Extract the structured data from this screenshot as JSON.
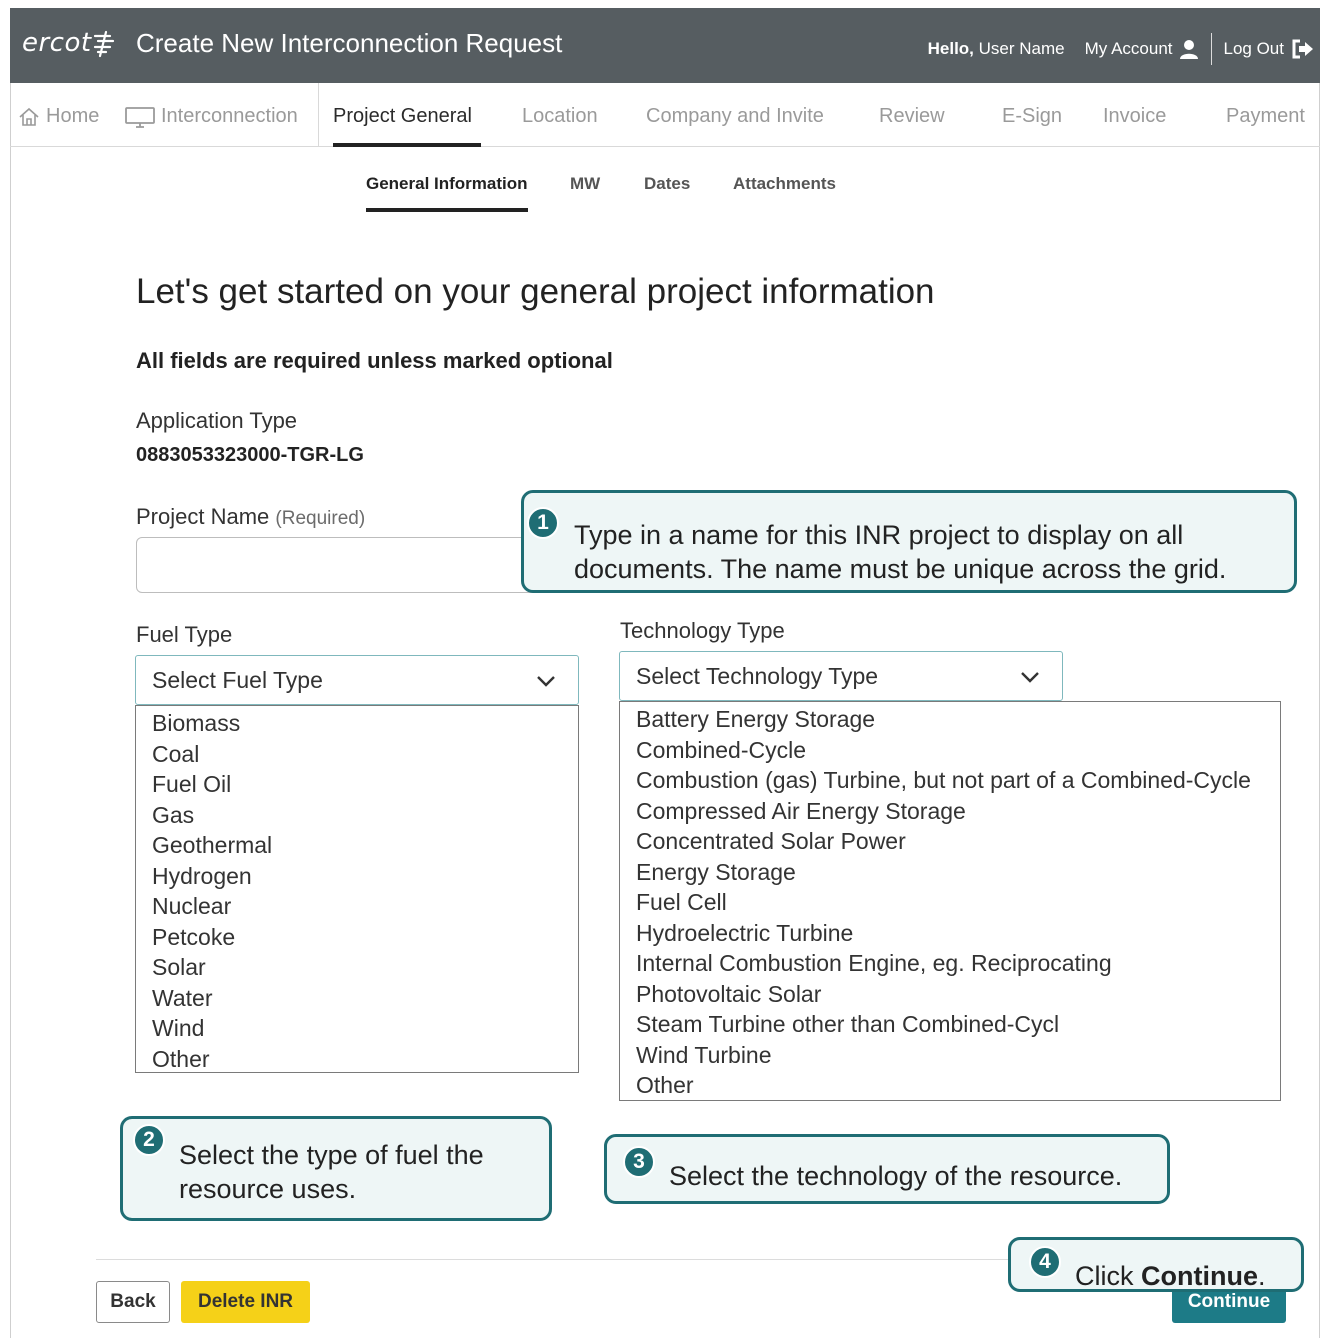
{
  "header": {
    "logo": "ercot",
    "title": "Create New Interconnection Request",
    "hello": "Hello,",
    "user_name": "User Name",
    "my_account": "My Account",
    "log_out": "Log Out"
  },
  "topnav": {
    "home": "Home",
    "interconnection": "Interconnection",
    "project_general": "Project General",
    "location": "Location",
    "company_and_invite": "Company and Invite",
    "review": "Review",
    "esign": "E-Sign",
    "invoice": "Invoice",
    "payment": "Payment"
  },
  "subtabs": {
    "general_information": "General Information",
    "mw": "MW",
    "dates": "Dates",
    "attachments": "Attachments"
  },
  "form": {
    "page_title": "Let's get started on your general project information",
    "required_note": "All fields are required unless marked optional",
    "application_type_label": "Application Type",
    "application_type_value": "0883053323000-TGR-LG",
    "project_name_label": "Project Name",
    "project_name_suffix": "(Required)",
    "project_name_value": "",
    "fuel_type_label": "Fuel Type",
    "fuel_type_placeholder": "Select Fuel Type",
    "fuel_type_options": [
      "Biomass",
      "Coal",
      "Fuel Oil",
      "Gas",
      "Geothermal",
      "Hydrogen",
      "Nuclear",
      "Petcoke",
      "Solar",
      "Water",
      "Wind",
      "Other"
    ],
    "technology_type_label": "Technology Type",
    "technology_type_placeholder": "Select Technology Type",
    "technology_type_options": [
      "Battery Energy Storage",
      "Combined-Cycle",
      "Combustion (gas) Turbine, but not part of a Combined-Cycle",
      "Compressed Air Energy Storage",
      "Concentrated Solar Power",
      "Energy Storage",
      "Fuel Cell",
      "Hydroelectric Turbine",
      "Internal Combustion Engine, eg. Reciprocating",
      "Photovoltaic Solar",
      "Steam Turbine other than Combined-Cycl",
      "Wind Turbine",
      "Other"
    ]
  },
  "buttons": {
    "back": "Back",
    "delete_inr": "Delete INR",
    "continue": "Continue"
  },
  "callouts": {
    "c1_num": "1",
    "c1_text": "Type in a name for this INR project to display on all documents. The name must be unique across the grid.",
    "c2_num": "2",
    "c2_text": "Select the type of fuel the resource uses.",
    "c3_num": "3",
    "c3_text": "Select the technology of the resource.",
    "c4_num": "4",
    "c4_prefix": "Click ",
    "c4_bold": "Continue",
    "c4_suffix": "."
  },
  "icons": {
    "logo_mark": "lightning-bolt-icon",
    "user": "user-icon",
    "logout": "logout-icon",
    "home": "home-icon",
    "monitor": "monitor-icon",
    "chevron": "chevron-down-icon"
  },
  "colors": {
    "header_bg": "#565d61",
    "accent_teal": "#1d7b87",
    "callout_border": "#1f6d74",
    "delete_yellow": "#f5d118"
  }
}
